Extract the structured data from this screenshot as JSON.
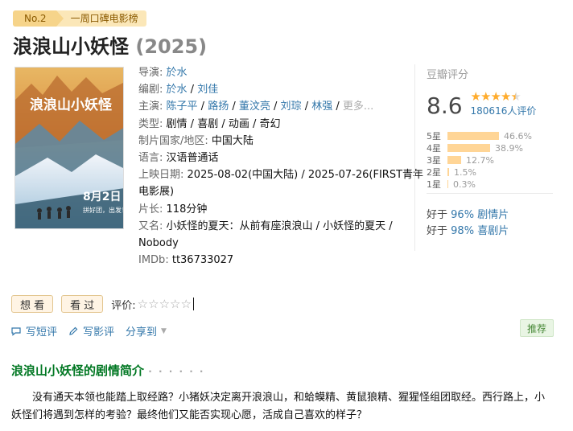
{
  "rank": {
    "no": "No.2",
    "list": "一周口碑电影榜"
  },
  "movie": {
    "title": "浪浪山小妖怪",
    "year": "(2025)"
  },
  "poster": {
    "title_text": "浪浪山小妖怪",
    "date_text": "8月2日",
    "slogan": "拼好团，出发！"
  },
  "info": {
    "director_label": "导演:",
    "director": "於水",
    "writer_label": "编剧:",
    "writers": [
      "於水",
      "刘佳"
    ],
    "cast_label": "主演:",
    "cast": [
      "陈子平",
      "路扬",
      "董汶亮",
      "刘琮",
      "林强"
    ],
    "more": "更多...",
    "genre_label": "类型:",
    "genres": [
      "剧情",
      "喜剧",
      "动画",
      "奇幻"
    ],
    "region_label": "制片国家/地区:",
    "region": "中国大陆",
    "language_label": "语言:",
    "language": "汉语普通话",
    "release_label": "上映日期:",
    "release_1": "2025-08-02(中国大陆) / 2025-07-26(FIRST青年",
    "release_2": "电影展)",
    "runtime_label": "片长:",
    "runtime": "118分钟",
    "aka_label": "又名:",
    "aka_1": "小妖怪的夏天：从前有座浪浪山 / 小妖怪的夏天 /",
    "aka_2": "Nobody",
    "imdb_label": "IMDb:",
    "imdb": "tt36733027",
    "sep": " / "
  },
  "rating": {
    "head": "豆瓣评分",
    "score": "8.6",
    "stars": 4.5,
    "votes": "180616人评价",
    "bars": [
      {
        "label": "5星",
        "pct": 46.6,
        "text": "46.6%"
      },
      {
        "label": "4星",
        "pct": 38.9,
        "text": "38.9%"
      },
      {
        "label": "3星",
        "pct": 12.7,
        "text": "12.7%"
      },
      {
        "label": "2星",
        "pct": 1.5,
        "text": "1.5%"
      },
      {
        "label": "1星",
        "pct": 0.3,
        "text": "0.3%"
      }
    ],
    "better": [
      {
        "prefix": "好于",
        "pct": "96%",
        "genre": "剧情片"
      },
      {
        "prefix": "好于",
        "pct": "98%",
        "genre": "喜剧片"
      }
    ]
  },
  "actions": {
    "want": "想 看",
    "seen": "看 过",
    "rate_label": "评价:",
    "empty_stars": "☆☆☆☆☆"
  },
  "tools": {
    "short_review": "写短评",
    "review": "写影评",
    "share": "分享到"
  },
  "recommend": "推荐",
  "section": {
    "title": "浪浪山小妖怪的剧情简介",
    "dots": "· · · · · ·"
  },
  "summary": "没有通天本领也能踏上取经路？小猪妖决定离开浪浪山，和蛤蟆精、黄鼠狼精、猩猩怪组团取经。西行路上，小妖怪们将遇到怎样的考验？最终他们又能否实现心愿，活成自己喜欢的样子？",
  "colors": {
    "link": "#3377aa",
    "star": "#ffac2d",
    "bar": "#ffd596",
    "section": "#007722"
  }
}
